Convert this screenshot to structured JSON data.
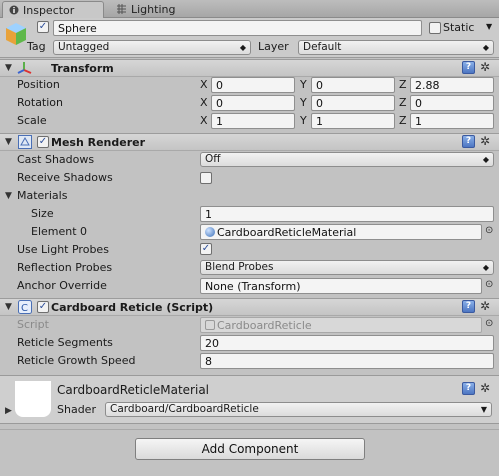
{
  "tabs": {
    "inspector": "Inspector",
    "lighting": "Lighting"
  },
  "header": {
    "object_name": "Sphere",
    "active": true,
    "static_label": "Static",
    "static_checked": false,
    "tag_label": "Tag",
    "tag_value": "Untagged",
    "layer_label": "Layer",
    "layer_value": "Default"
  },
  "transform": {
    "title": "Transform",
    "position_label": "Position",
    "rotation_label": "Rotation",
    "scale_label": "Scale",
    "x": "X",
    "y": "Y",
    "z": "Z",
    "position": {
      "x": "0",
      "y": "0",
      "z": "2.88"
    },
    "rotation": {
      "x": "0",
      "y": "0",
      "z": "0"
    },
    "scale": {
      "x": "1",
      "y": "1",
      "z": "1"
    }
  },
  "mesh_renderer": {
    "title": "Mesh Renderer",
    "enabled": true,
    "cast_shadows_label": "Cast Shadows",
    "cast_shadows_value": "Off",
    "receive_shadows_label": "Receive Shadows",
    "receive_shadows": false,
    "materials_label": "Materials",
    "size_label": "Size",
    "size_value": "1",
    "element0_label": "Element 0",
    "element0_value": "CardboardReticleMaterial",
    "use_light_probes_label": "Use Light Probes",
    "use_light_probes": true,
    "reflection_probes_label": "Reflection Probes",
    "reflection_probes_value": "Blend Probes",
    "anchor_override_label": "Anchor Override",
    "anchor_override_value": "None (Transform)"
  },
  "cardboard_reticle": {
    "title": "Cardboard Reticle (Script)",
    "enabled": true,
    "script_label": "Script",
    "script_value": "CardboardReticle",
    "segments_label": "Reticle Segments",
    "segments_value": "20",
    "growth_label": "Reticle Growth Speed",
    "growth_value": "8"
  },
  "material": {
    "name": "CardboardReticleMaterial",
    "shader_label": "Shader",
    "shader_value": "Cardboard/CardboardReticle"
  },
  "add_component_label": "Add Component",
  "icons": [
    "info-icon",
    "lighting-icon",
    "cube-icon",
    "axes-icon",
    "mesh-icon",
    "script-icon",
    "help-icon",
    "gear-icon",
    "object-picker-icon"
  ]
}
